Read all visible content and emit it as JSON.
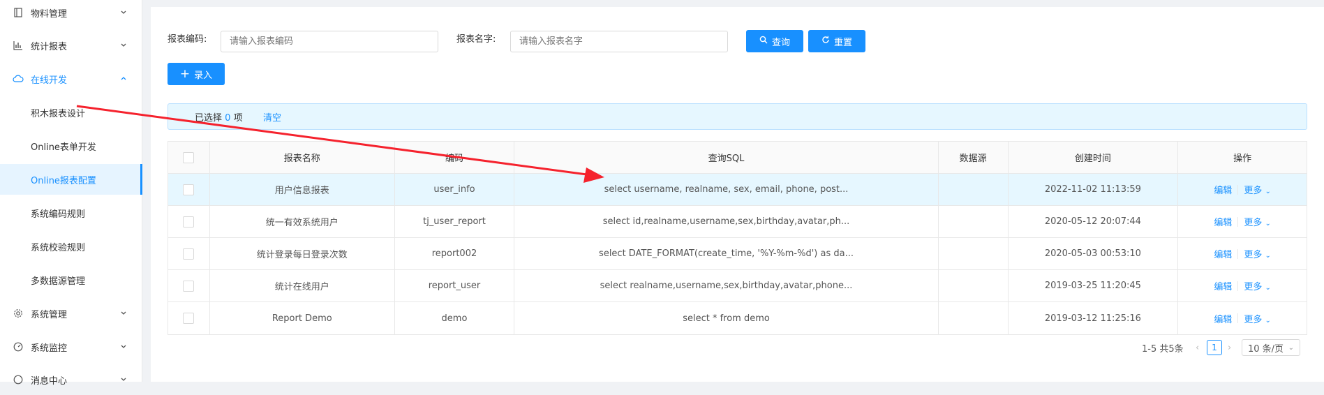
{
  "sidebar": {
    "items": [
      {
        "label": "物料管理",
        "icon": "book-icon"
      },
      {
        "label": "统计报表",
        "icon": "bar-chart-icon"
      },
      {
        "label": "在线开发",
        "icon": "cloud-icon"
      },
      {
        "label": "系统管理",
        "icon": "gear-icon"
      },
      {
        "label": "系统监控",
        "icon": "dashboard-icon"
      },
      {
        "label": "消息中心",
        "icon": "message-icon"
      }
    ],
    "sub_items": [
      "积木报表设计",
      "Online表单开发",
      "Online报表配置",
      "系统编码规则",
      "系统校验规则",
      "多数据源管理"
    ]
  },
  "search": {
    "code_label": "报表编码:",
    "code_placeholder": "请输入报表编码",
    "name_label": "报表名字:",
    "name_placeholder": "请输入报表名字",
    "query_button": "查询",
    "reset_button": "重置"
  },
  "toolbar": {
    "add_button": "录入"
  },
  "alert": {
    "prefix": "已选择",
    "count": "0",
    "suffix": "项",
    "clear": "清空"
  },
  "table": {
    "headers": [
      "报表名称",
      "编码",
      "查询SQL",
      "数据源",
      "创建时间",
      "操作"
    ],
    "rows": [
      {
        "name": "用户信息报表",
        "code": "user_info",
        "sql": "select username, realname, sex, email, phone, post...",
        "source": "",
        "time": "2022-11-02 11:13:59"
      },
      {
        "name": "统一有效系统用户",
        "code": "tj_user_report",
        "sql": "select id,realname,username,sex,birthday,avatar,ph...",
        "source": "",
        "time": "2020-05-12 20:07:44"
      },
      {
        "name": "统计登录每日登录次数",
        "code": "report002",
        "sql": "select DATE_FORMAT(create_time, '%Y-%m-%d') as da...",
        "source": "",
        "time": "2020-05-03 00:53:10"
      },
      {
        "name": "统计在线用户",
        "code": "report_user",
        "sql": "select realname,username,sex,birthday,avatar,phone...",
        "source": "",
        "time": "2019-03-25 11:20:45"
      },
      {
        "name": "Report Demo",
        "code": "demo",
        "sql": "select * from demo",
        "source": "",
        "time": "2019-03-12 11:25:16"
      }
    ],
    "action_edit": "编辑",
    "action_more": "更多"
  },
  "pagination": {
    "summary": "1-5 共5条",
    "current_page": "1",
    "page_size": "10 条/页"
  },
  "colors": {
    "accent": "#1890ff",
    "arrow": "#f5222d"
  }
}
